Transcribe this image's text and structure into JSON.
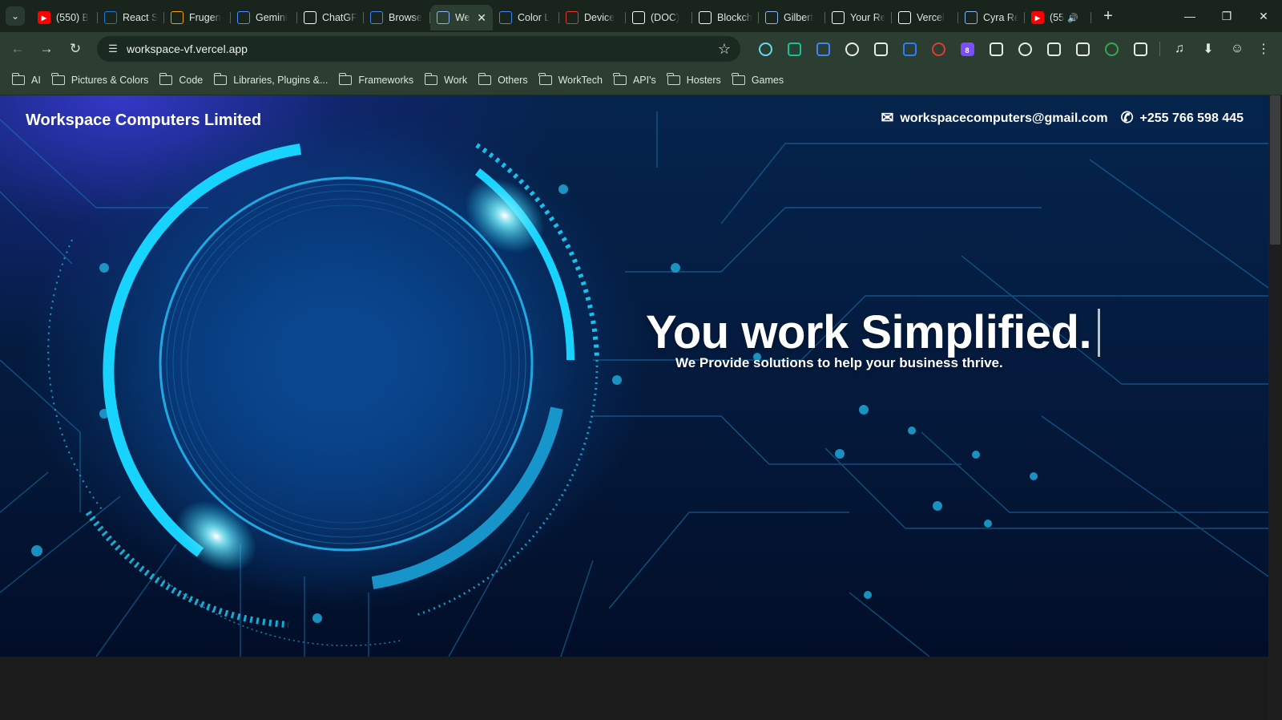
{
  "tabs": [
    {
      "title": "(550) B",
      "icon": "youtube-icon",
      "color": "#ff0000"
    },
    {
      "title": "React S",
      "icon": "mui-icon",
      "color": "#1976d2"
    },
    {
      "title": "Frugen",
      "icon": "frugen-icon",
      "color": "#f59e0b"
    },
    {
      "title": "Gemini",
      "icon": "gemini-icon",
      "color": "#4e8cff"
    },
    {
      "title": "ChatGF",
      "icon": "chatgpt-icon",
      "color": "#ffffff"
    },
    {
      "title": "Browse",
      "icon": "chrome-icon",
      "color": "#4285f4"
    },
    {
      "title": "We",
      "icon": "rocket-icon",
      "color": "#8ab4f8",
      "active": true
    },
    {
      "title": "Color L",
      "icon": "chrome-icon",
      "color": "#4285f4"
    },
    {
      "title": "Device",
      "icon": "x-mark-icon",
      "color": "#e53935"
    },
    {
      "title": "(DOC)",
      "icon": "doc-a-icon",
      "color": "#ffffff"
    },
    {
      "title": "Blockch",
      "icon": "blockchain-icon",
      "color": "#ffffff"
    },
    {
      "title": "Gilbert",
      "icon": "rocket-icon",
      "color": "#8ab4f8"
    },
    {
      "title": "Your Re",
      "icon": "github-icon",
      "color": "#ffffff"
    },
    {
      "title": "Vercel",
      "icon": "vercel-icon",
      "color": "#ffffff"
    },
    {
      "title": "Cyra Re",
      "icon": "rocket-icon",
      "color": "#8ab4f8"
    },
    {
      "title": "(55",
      "icon": "youtube-icon",
      "color": "#ff0000",
      "audio": true
    }
  ],
  "address": {
    "url": "workspace-vf.vercel.app"
  },
  "extensions": [
    {
      "name": "react-devtools-icon",
      "color": "#61dafb"
    },
    {
      "name": "grammarly-icon",
      "color": "#15c39a"
    },
    {
      "name": "google-docs-icon",
      "color": "#4285f4"
    },
    {
      "name": "eyedropper-icon",
      "color": "#e7ece9"
    },
    {
      "name": "fx-icon",
      "color": "#e7ece9"
    },
    {
      "name": "fi-icon",
      "color": "#2d7ff9"
    },
    {
      "name": "adblock-plus-icon",
      "color": "#e53935"
    },
    {
      "name": "extension-badge-icon",
      "color": "#7c4dff",
      "badge": "8"
    },
    {
      "name": "glasses-icon",
      "color": "#e7ece9"
    },
    {
      "name": "box-icon",
      "color": "#e7ece9"
    },
    {
      "name": "vuetify-icon",
      "color": "#e7ece9"
    },
    {
      "name": "alien-icon",
      "color": "#e7ece9"
    },
    {
      "name": "sheet-icon",
      "color": "#34a853"
    },
    {
      "name": "puzzle-icon",
      "color": "#e7ece9"
    }
  ],
  "bookmarks": [
    "AI",
    "Pictures & Colors",
    "Code",
    "Libraries, Plugins &...",
    "Frameworks",
    "Work",
    "Others",
    "WorkTech",
    "API's",
    "Hosters",
    "Games"
  ],
  "site": {
    "brand": "Workspace Computers Limited",
    "email": "workspacecomputers@gmail.com",
    "phone": "+255 766 598 445",
    "headline": "You work Simplified.",
    "subheadline": "We Provide solutions to help your business thrive."
  },
  "colors": {
    "accent_cyan": "#19d3ff",
    "hero_blue": "#073673",
    "browser_chrome": "#2c3d32"
  }
}
